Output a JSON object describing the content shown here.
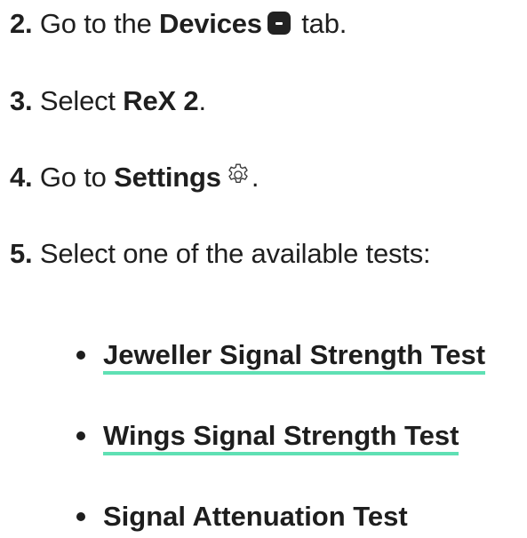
{
  "steps": [
    {
      "number": "2.",
      "parts": {
        "text1": " Go to the ",
        "bold1": "Devices",
        "text2": " tab."
      },
      "icon": "devices-tab-icon"
    },
    {
      "number": "3.",
      "parts": {
        "text1": " Select ",
        "bold1": "ReX 2",
        "text2": "."
      }
    },
    {
      "number": "4.",
      "parts": {
        "text1": " Go to ",
        "bold1": "Settings",
        "text2": "."
      },
      "icon": "gear-icon"
    },
    {
      "number": "5.",
      "parts": {
        "text1": " Select one of the available tests:"
      }
    }
  ],
  "tests": [
    {
      "label": "Jeweller Signal Strength Test",
      "is_link": true
    },
    {
      "label": "Wings Signal Strength Test",
      "is_link": true
    },
    {
      "label": "Signal Attenuation Test",
      "is_link": false
    }
  ],
  "colors": {
    "text": "#1e1e1e",
    "link_underline": "#5fe0b4",
    "icon_dark": "#222222"
  }
}
